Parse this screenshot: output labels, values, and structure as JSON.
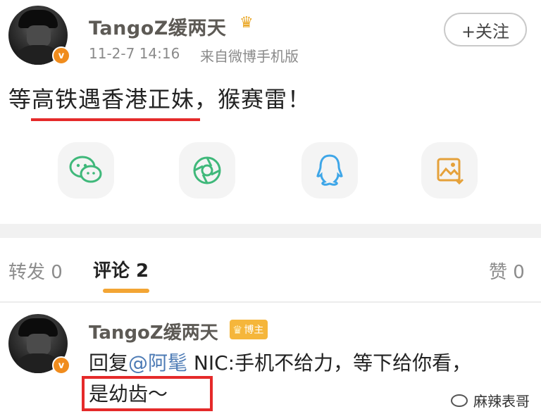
{
  "post": {
    "username": "TangoZ缓两天",
    "crown_icon": "crown-icon",
    "verified_badge": "v",
    "timestamp": "11-2-7 14:16",
    "source": "来自微博手机版",
    "follow_label": "+关注",
    "text": "等高铁遇香港正妹，猴赛雷！"
  },
  "share_buttons": [
    {
      "icon": "wechat-icon"
    },
    {
      "icon": "moments-icon"
    },
    {
      "icon": "qq-icon"
    },
    {
      "icon": "save-image-icon"
    }
  ],
  "tabs": {
    "repost": "转发 0",
    "comments": "评论 2",
    "likes": "赞 0"
  },
  "comment": {
    "username": "TangoZ缓两天",
    "owner_badge": "博主",
    "reply_prefix": "回复",
    "mention": "@阿髦",
    "reply_rest_line1": " NIC:手机不给力，等下给你看，",
    "line2": "是幼齿～"
  },
  "watermark": "麻辣表哥",
  "colors": {
    "accent_orange": "#f3a534",
    "annotation_red": "#e52a2a",
    "mention_blue": "#4d7bb5"
  }
}
